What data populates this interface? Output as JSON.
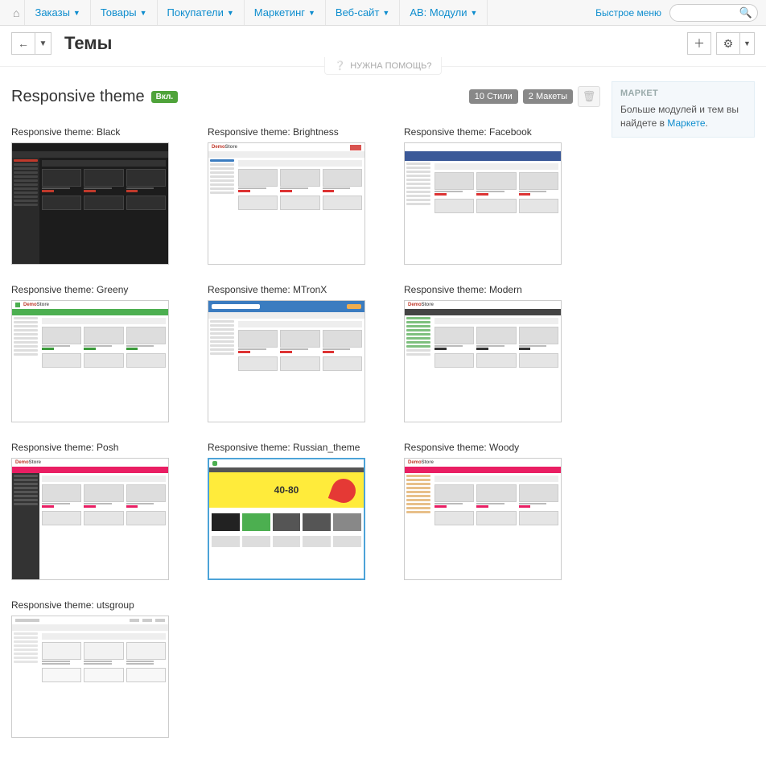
{
  "nav": {
    "home": "⌂",
    "items": [
      "Заказы",
      "Товары",
      "Покупатели",
      "Маркетинг",
      "Веб-сайт",
      "AB: Модули"
    ],
    "quick": "Быстрое меню",
    "search_placeholder": ""
  },
  "titlebar": {
    "title": "Темы"
  },
  "help": {
    "text": "НУЖНА ПОМОЩЬ?"
  },
  "subheader": {
    "theme_name": "Responsive theme",
    "label": "Вкл.",
    "badge_styles": "10 Стили",
    "badge_layouts": "2 Макеты"
  },
  "sidebar": {
    "heading": "МАРКЕТ",
    "text_before": "Больше модулей и тем вы найдете в ",
    "link": "Маркете",
    "text_after": "."
  },
  "themes": [
    {
      "title": "Responsive theme: Black"
    },
    {
      "title": "Responsive theme: Brightness"
    },
    {
      "title": "Responsive theme: Facebook"
    },
    {
      "title": "Responsive theme: Greeny"
    },
    {
      "title": "Responsive theme: MTronX"
    },
    {
      "title": "Responsive theme: Modern"
    },
    {
      "title": "Responsive theme: Posh"
    },
    {
      "title": "Responsive theme: Russian_theme",
      "selected": true
    },
    {
      "title": "Responsive theme: Woody"
    },
    {
      "title": "Responsive theme: utsgroup"
    }
  ],
  "rus_banner": "40-80"
}
